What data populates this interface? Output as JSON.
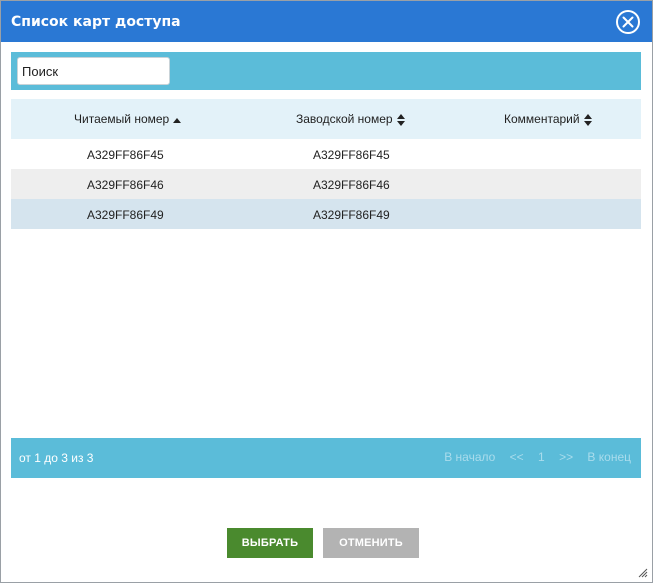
{
  "dialog": {
    "title": "Список карт доступа"
  },
  "search": {
    "placeholder": "Поиск"
  },
  "table": {
    "columns": [
      "Читаемый номер",
      "Заводской номер",
      "Комментарий"
    ],
    "rows": [
      [
        "A329FF86F45",
        "A329FF86F45",
        ""
      ],
      [
        "A329FF86F46",
        "A329FF86F46",
        ""
      ],
      [
        "A329FF86F49",
        "A329FF86F49",
        ""
      ]
    ]
  },
  "footer": {
    "info": "от 1 до 3 из 3",
    "pager": {
      "first": "В начало",
      "prev": "<<",
      "page": "1",
      "next": ">>",
      "last": "В конец"
    }
  },
  "buttons": {
    "select": "ВЫБРАТЬ",
    "cancel": "ОТМЕНИТЬ"
  },
  "colors": {
    "titlebar": "#2a78d4",
    "toolbar": "#5bbcd9",
    "select_button": "#4a8a2e",
    "cancel_button": "#b3b3b3"
  }
}
